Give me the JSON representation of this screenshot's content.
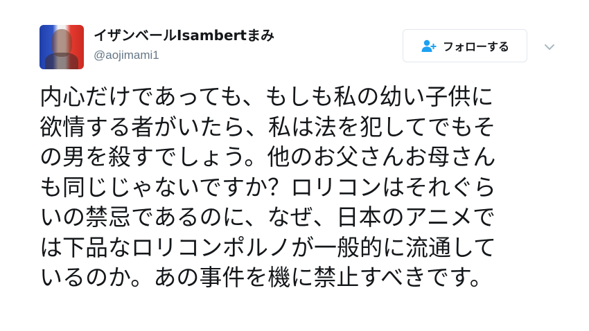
{
  "user": {
    "display_name": "イザンベールIsambertまみ",
    "handle": "@aojimami1",
    "avatar_icon": "profile-photo-french-flag"
  },
  "follow_button": {
    "label": "フォローする",
    "icon": "add-user-icon",
    "accent_color": "#1da1f2"
  },
  "menu": {
    "icon": "chevron-down-icon"
  },
  "tweet": {
    "lines": [
      "内心だけであっても、もしも私の幼い子供に",
      "欲情する者がいたら、私は法を犯してでもそ",
      "の男を殺すでしょう。他のお父さんお母さん",
      "も同じじゃないですか？ロリコンはそれぐら",
      "いの禁忌であるのに、なぜ、日本のアニメで",
      "は下品なロリコンポルノが一般的に流通して",
      "いるのか。あの事件を機に禁止すべきです。"
    ]
  }
}
